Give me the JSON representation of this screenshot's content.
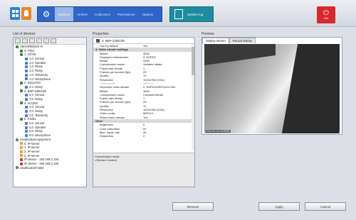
{
  "nav": {
    "tabs": [
      "Devices",
      "Archive",
      "Collections",
      "Permissions",
      "Options"
    ],
    "active_tab": "Devices"
  },
  "system_log": {
    "label": "System log"
  },
  "exit": {
    "label": "Exit"
  },
  "devices": {
    "title": "List of devices",
    "tree": [
      {
        "label": "AMAGREDSO-N",
        "level": 0,
        "color": "#3a8a3a"
      },
      {
        "label": "0. F301",
        "level": 1,
        "color": "#3a8a3a"
      },
      {
        "label": "1. G3TM",
        "level": 1,
        "color": "#3a8a3a"
      },
      {
        "label": "1.0. Sensor",
        "level": 2,
        "color": "#4a7ac8"
      },
      {
        "label": "1.0. Speaker",
        "level": 2,
        "color": "#4a7ac8"
      },
      {
        "label": "1.0. Relay",
        "level": 2,
        "color": "#4a7ac8"
      },
      {
        "label": "1.0. Relay",
        "level": 2,
        "color": "#4a7ac8"
      },
      {
        "label": "1.0. Telemetry",
        "level": 2,
        "color": "#4a7ac8"
      },
      {
        "label": "1.0. Microphone",
        "level": 2,
        "color": "#4a7ac8"
      },
      {
        "label": "2. IQeye703",
        "level": 1,
        "color": "#3a8a3a"
      },
      {
        "label": "2.0. Relay",
        "level": 2,
        "color": "#4a7ac8"
      },
      {
        "label": "3. BEP-1300cdN",
        "level": 1,
        "color": "#3a8a3a"
      },
      {
        "label": "3.0. Sensor",
        "level": 2,
        "color": "#4a7ac8"
      },
      {
        "label": "3.0. Relay",
        "level": 2,
        "color": "#4a7ac8"
      },
      {
        "label": "4. AV1300",
        "level": 1,
        "color": "#3a8a3a"
      },
      {
        "label": "4.0. Sensor",
        "level": 2,
        "color": "#4a7ac8"
      },
      {
        "label": "4.0. Relay",
        "level": 2,
        "color": "#4a7ac8"
      },
      {
        "label": "4.0. Telemetry",
        "level": 2,
        "color": "#4a7ac8"
      },
      {
        "label": "5. F3301",
        "level": 1,
        "color": "#3a8a3a"
      },
      {
        "label": "5.0. Sensor",
        "level": 2,
        "color": "#4a7ac8"
      },
      {
        "label": "5.0. Speaker",
        "level": 2,
        "color": "#4a7ac8"
      },
      {
        "label": "5.0. Relay",
        "level": 2,
        "color": "#4a7ac8"
      },
      {
        "label": "5.0. Microphone",
        "level": 2,
        "color": "#4a7ac8"
      },
      {
        "label": "Unallocated equipment",
        "level": 0,
        "color": "#777777"
      },
      {
        "label": "0. IP-server",
        "level": 1,
        "color": "#d9a23a"
      },
      {
        "label": "1. IP-server",
        "level": 1,
        "color": "#d9a23a"
      },
      {
        "label": "2. IP-server",
        "level": 1,
        "color": "#d9a23a"
      },
      {
        "label": "3. IP-server",
        "level": 1,
        "color": "#d9a23a"
      },
      {
        "label": "IP-device - 192.168.2.136",
        "level": 1,
        "color": "#cc3333"
      },
      {
        "label": "IP-device - 192.168.2.136",
        "level": 1,
        "color": "#cc3333"
      },
      {
        "label": "Unallocated hosts",
        "level": 0,
        "color": "#777777"
      }
    ]
  },
  "properties": {
    "title": "Properties",
    "device": "3. BEP-1300cdN",
    "rows": [
      {
        "k": "Use by default",
        "v": "Yes",
        "type": "row"
      },
      {
        "k": "4. Video stream settings",
        "v": "",
        "type": "sec"
      },
      {
        "k": "Bitrate",
        "v": "3000",
        "type": "row"
      },
      {
        "k": "Displayed videostream",
        "v": "0. MJPEG",
        "type": "row"
      },
      {
        "k": "Bitrate",
        "v": "3000",
        "type": "row"
      },
      {
        "k": "Compression mode",
        "v": "Variable bitrate",
        "type": "row"
      },
      {
        "k": "Frame rate divider",
        "v": "1",
        "type": "row"
      },
      {
        "k": "Frames per second (fps)",
        "v": "25",
        "type": "row"
      },
      {
        "k": "Quality",
        "v": "70",
        "type": "row"
      },
      {
        "k": "Resolution",
        "v": "1024x768 (XGA)",
        "type": "row"
      },
      {
        "k": "Video codec",
        "v": "MPEG4",
        "type": "grey"
      },
      {
        "k": "Recorded video stream",
        "v": "0. MJPEG/MPEG4/H.264",
        "type": "row"
      },
      {
        "k": "Bitrate",
        "v": "3000",
        "type": "row"
      },
      {
        "k": "Compression mode",
        "v": "Constant bitrate",
        "type": "row"
      },
      {
        "k": "Frame rate divider",
        "v": "1",
        "type": "row"
      },
      {
        "k": "Frames per second (fps)",
        "v": "25",
        "type": "row"
      },
      {
        "k": "Quality",
        "v": "70",
        "type": "row"
      },
      {
        "k": "Resolution",
        "v": "1024x768 (XGA)",
        "type": "row"
      },
      {
        "k": "Video codec",
        "v": "MPEG4",
        "type": "row"
      },
      {
        "k": "Select video stream",
        "v": "Yes",
        "type": "row"
      },
      {
        "k": "Other",
        "v": "",
        "type": "sec"
      },
      {
        "k": "Brightness",
        "v": "0",
        "type": "row"
      },
      {
        "k": "Color saturation",
        "v": "50",
        "type": "row"
      },
      {
        "k": "Max. frame rate",
        "v": "25",
        "type": "row"
      },
      {
        "k": "Sharpness",
        "v": "0",
        "type": "row"
      }
    ],
    "description_title": "Compression mode",
    "description_text": "<Stream-Control>"
  },
  "preview": {
    "title": "Preview",
    "tabs": [
      "Display stream",
      "Record stream"
    ],
    "timestamp": "2010-01-01 12:00:00"
  },
  "buttons": {
    "remove": "Remove",
    "apply": "Apply",
    "cancel": "Cancel"
  }
}
